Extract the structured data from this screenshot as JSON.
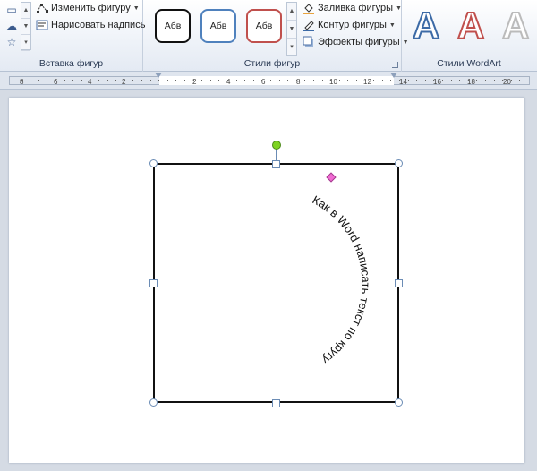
{
  "ribbon": {
    "insert_shapes": {
      "label": "Вставка фигур",
      "edit_shape": "Изменить фигуру",
      "draw_textbox": "Нарисовать надпись"
    },
    "shape_styles": {
      "label": "Стили фигур",
      "presets": [
        "Абв",
        "Абв",
        "Абв"
      ],
      "fill": "Заливка фигуры",
      "outline": "Контур фигуры",
      "effects": "Эффекты фигуры"
    },
    "wordart_styles": {
      "label": "Стили WordArt",
      "glyph": "A"
    }
  },
  "ruler": {
    "labels": [
      "8",
      "6",
      "4",
      "2",
      "2",
      "4",
      "6",
      "8",
      "10",
      "12",
      "14",
      "16",
      "18",
      "20"
    ]
  },
  "document": {
    "arc_text": "Как в Word написать текст по кругу"
  },
  "colors": {
    "accent_blue": "#4f81bd",
    "accent_red": "#c0504d",
    "rotate_handle": "#7ed321",
    "adjust_handle": "#f06ad2"
  }
}
